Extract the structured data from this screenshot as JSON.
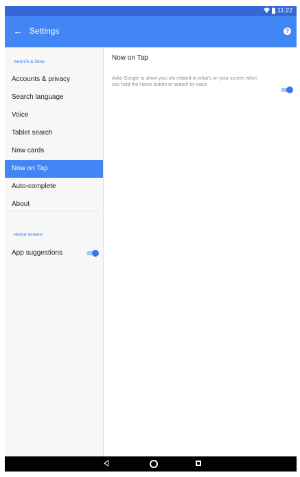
{
  "status_bar": {
    "time": "11:22",
    "wifi_icon": "wifi-icon",
    "battery_icon": "battery-icon"
  },
  "app_bar": {
    "title": "Settings",
    "back_icon": "arrow-back-icon",
    "help_icon": "help-icon"
  },
  "sidebar": {
    "section1_header": "Search & Now",
    "items": [
      {
        "label": "Accounts & privacy",
        "selected": false
      },
      {
        "label": "Search language",
        "selected": false
      },
      {
        "label": "Voice",
        "selected": false
      },
      {
        "label": "Tablet search",
        "selected": false
      },
      {
        "label": "Now cards",
        "selected": false
      },
      {
        "label": "Now on Tap",
        "selected": true
      },
      {
        "label": "Auto-complete",
        "selected": false
      },
      {
        "label": "About",
        "selected": false
      }
    ],
    "section2_header": "Home screen",
    "app_suggestions": {
      "label": "App suggestions",
      "enabled": true
    }
  },
  "main": {
    "title": "Now on Tap",
    "description": "Asks Google to show you info related to what's on your screen when you hold the Home button or search by voice",
    "toggle_enabled": true
  },
  "nav_bar": {
    "back_icon": "back-icon",
    "home_icon": "home-icon",
    "recents_icon": "recents-icon"
  },
  "colors": {
    "primary": "#4285f4",
    "status_bar": "#3367d6",
    "toggle_thumb": "#3b78e7",
    "toggle_track": "#a8c7fa"
  }
}
